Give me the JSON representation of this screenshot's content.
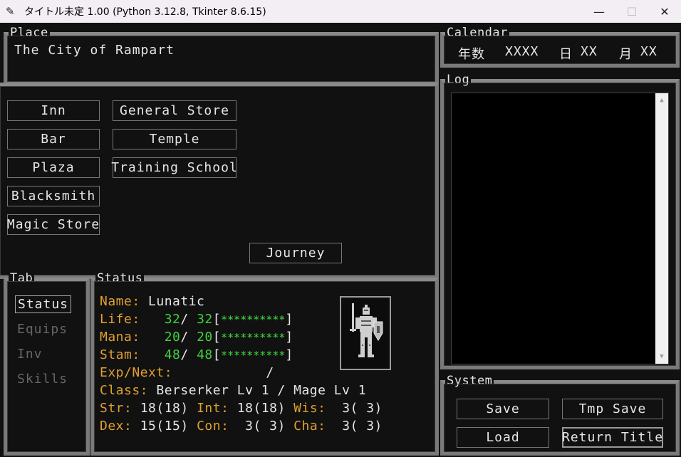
{
  "window": {
    "title": "タイトル未定 1.00 (Python 3.12.8, Tkinter 8.6.15)",
    "minimize": "—",
    "maximize": "☐",
    "close": "✕"
  },
  "place": {
    "label": "Place",
    "name": "The City of Rampart"
  },
  "locations": {
    "inn": "Inn",
    "bar": "Bar",
    "plaza": "Plaza",
    "blacksmith": "Blacksmith",
    "magic_store": "Magic Store",
    "general_store": "General Store",
    "temple": "Temple",
    "training_school": "Training School",
    "journey": "Journey"
  },
  "calendar": {
    "label": "Calendar",
    "year_label": "年数",
    "year_value": "XXXX",
    "day_label": "日",
    "day_value": "XX",
    "month_label": "月",
    "month_value": "XX"
  },
  "log": {
    "label": "Log"
  },
  "tab": {
    "label": "Tab",
    "items": [
      "Status",
      "Equips",
      "Inv",
      "Skills"
    ]
  },
  "status": {
    "label": "Status",
    "name_label": "Name:",
    "name": "Lunatic",
    "life_label": "Life:",
    "life_cur": "32",
    "life_max": "32",
    "life_bar": "**********",
    "mana_label": "Mana:",
    "mana_cur": "20",
    "mana_max": "20",
    "mana_bar": "**********",
    "stam_label": "Stam:",
    "stam_cur": "48",
    "stam_max": "48",
    "stam_bar": "**********",
    "exp_label": "Exp/Next:",
    "exp_value": "/",
    "class_label": "Class:",
    "class_value": "Berserker Lv 1 / Mage Lv 1",
    "str_label": "Str:",
    "str_value": "18(18)",
    "int_label": "Int:",
    "int_value": "18(18)",
    "wis_label": "Wis:",
    "wis_value": " 3( 3)",
    "dex_label": "Dex:",
    "dex_value": "15(15)",
    "con_label": "Con:",
    "con_value": " 3( 3)",
    "cha_label": "Cha:",
    "cha_value": " 3( 3)"
  },
  "system": {
    "label": "System",
    "save": "Save",
    "tmp_save": "Tmp Save",
    "load": "Load",
    "return_title": "Return Title"
  },
  "colors": {
    "background": "#111111",
    "label_orange": "#e0a030",
    "value_green": "#40d040",
    "frame_gray": "#7a7a7a"
  }
}
